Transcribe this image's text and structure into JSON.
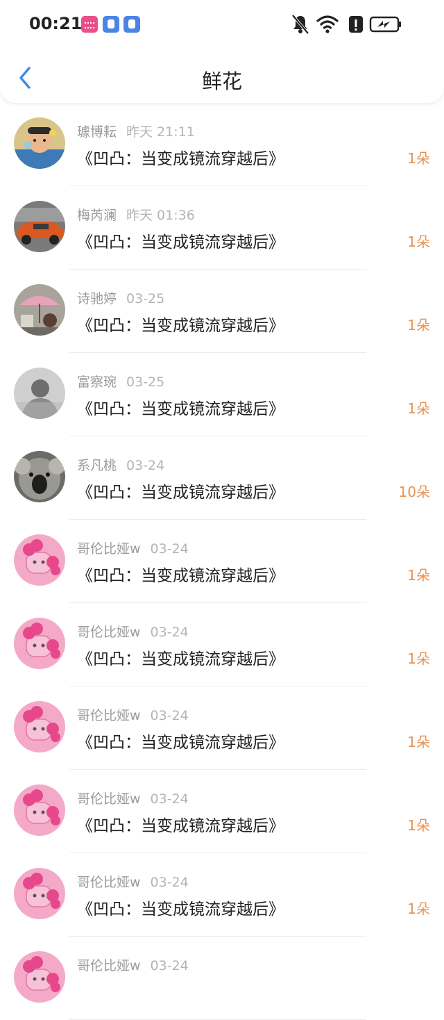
{
  "status_bar": {
    "time": "00:21",
    "app_icons": [
      "bilibili-icon",
      "blue-app-icon",
      "blue-app-icon"
    ],
    "icons": [
      "mute-bell-icon",
      "wifi-icon",
      "alert-icon",
      "battery-charging-icon"
    ]
  },
  "header": {
    "back_icon": "chevron-left-icon",
    "title": "鲜花",
    "accent_color": "#3d8ae0"
  },
  "list": [
    {
      "user": "璩博耘",
      "time": "昨天 21:11",
      "book": "《凹凸：当变成镜流穿越后》",
      "count": "1朵",
      "avatar": "child-with-bubbles"
    },
    {
      "user": "梅芮澜",
      "time": "昨天 01:36",
      "book": "《凹凸：当变成镜流穿越后》",
      "count": "1朵",
      "avatar": "orange-car"
    },
    {
      "user": "诗驰婷",
      "time": "03-25",
      "book": "《凹凸：当变成镜流穿越后》",
      "count": "1朵",
      "avatar": "pink-umbrella"
    },
    {
      "user": "富察琬",
      "time": "03-25",
      "book": "《凹凸：当变成镜流穿越后》",
      "count": "1朵",
      "avatar": "gray-portrait"
    },
    {
      "user": "系凡桃",
      "time": "03-24",
      "book": "《凹凸：当变成镜流穿越后》",
      "count": "10朵",
      "avatar": "koala"
    },
    {
      "user": "哥伦比娅w",
      "time": "03-24",
      "book": "《凹凸：当变成镜流穿越后》",
      "count": "1朵",
      "avatar": "pink-pony"
    },
    {
      "user": "哥伦比娅w",
      "time": "03-24",
      "book": "《凹凸：当变成镜流穿越后》",
      "count": "1朵",
      "avatar": "pink-pony"
    },
    {
      "user": "哥伦比娅w",
      "time": "03-24",
      "book": "《凹凸：当变成镜流穿越后》",
      "count": "1朵",
      "avatar": "pink-pony"
    },
    {
      "user": "哥伦比娅w",
      "time": "03-24",
      "book": "《凹凸：当变成镜流穿越后》",
      "count": "1朵",
      "avatar": "pink-pony"
    },
    {
      "user": "哥伦比娅w",
      "time": "03-24",
      "book": "《凹凸：当变成镜流穿越后》",
      "count": "1朵",
      "avatar": "pink-pony"
    },
    {
      "user": "哥伦比娅w",
      "time": "03-24",
      "book": "",
      "count": "",
      "avatar": "pink-pony"
    }
  ],
  "colors": {
    "count": "#e79352",
    "username": "#9b9b9b",
    "time": "#b4b4b4",
    "book": "#222222"
  }
}
